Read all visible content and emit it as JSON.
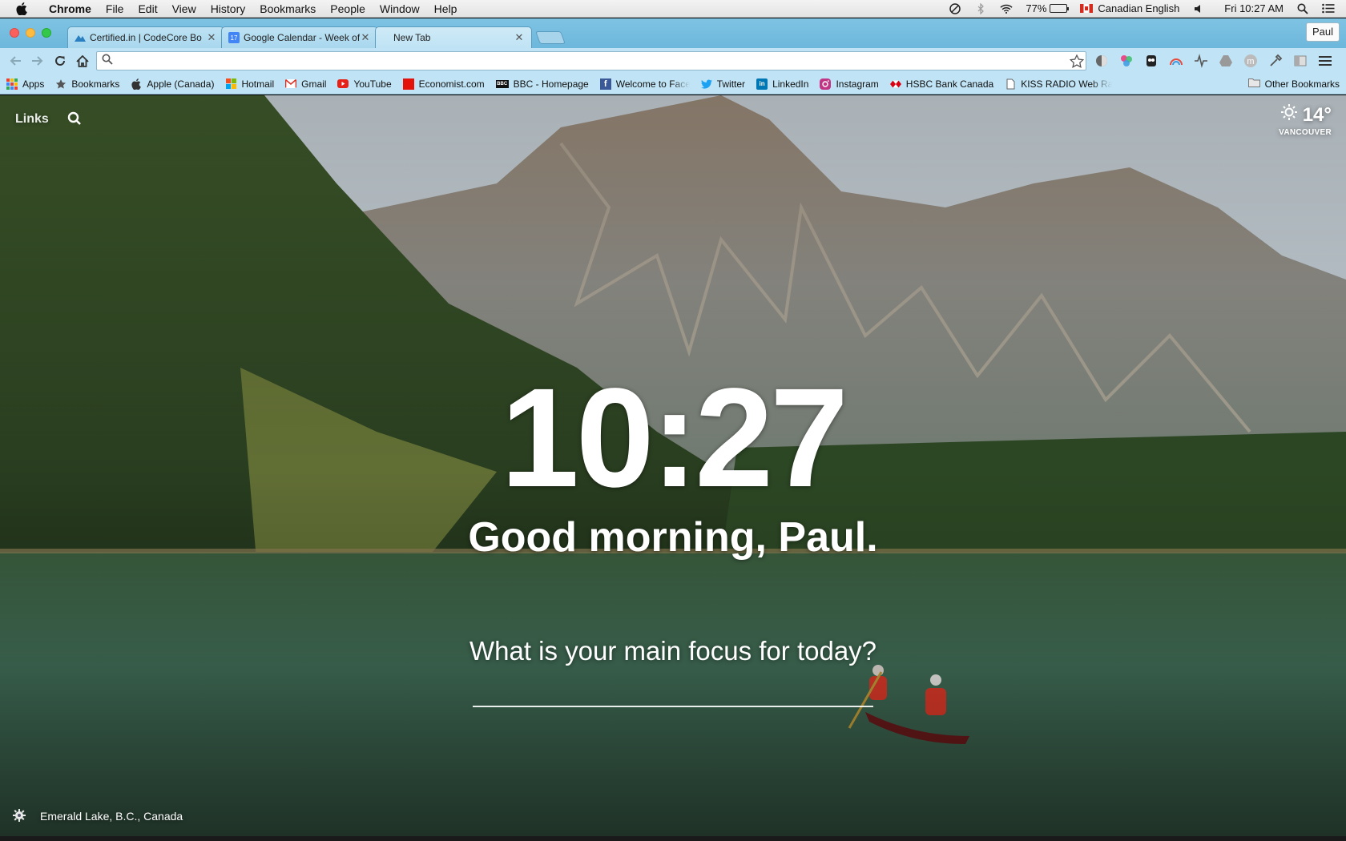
{
  "menubar": {
    "app_name": "Chrome",
    "menus": [
      "File",
      "Edit",
      "View",
      "History",
      "Bookmarks",
      "People",
      "Window",
      "Help"
    ],
    "battery_percent": "77%",
    "input_source": "Canadian English",
    "datetime": "Fri 10:27 AM"
  },
  "tabs": [
    {
      "title": "Certified.in | CodeCore Bo",
      "favicon": "codecore-icon",
      "active": false
    },
    {
      "title": "Google Calendar - Week of",
      "favicon": "calendar-icon",
      "favicon_text": "17",
      "active": false
    },
    {
      "title": "New Tab",
      "favicon": "",
      "active": true
    }
  ],
  "profile_name": "Paul",
  "omnibox": {
    "value": "",
    "placeholder": ""
  },
  "bookmarks": [
    {
      "label": "Apps",
      "icon": "apps-grid-icon"
    },
    {
      "label": "Bookmarks",
      "icon": "star-icon"
    },
    {
      "label": "Apple (Canada)",
      "icon": "apple-icon"
    },
    {
      "label": "Hotmail",
      "icon": "windows-icon"
    },
    {
      "label": "Gmail",
      "icon": "gmail-icon"
    },
    {
      "label": "YouTube",
      "icon": "youtube-icon"
    },
    {
      "label": "Economist.com",
      "icon": "economist-icon"
    },
    {
      "label": "BBC - Homepage",
      "icon": "bbc-icon",
      "icon_text": "BBC"
    },
    {
      "label": "Welcome to Faceboo",
      "icon": "facebook-icon",
      "icon_text": "f"
    },
    {
      "label": "Twitter",
      "icon": "twitter-icon"
    },
    {
      "label": "LinkedIn",
      "icon": "linkedin-icon",
      "icon_text": "in"
    },
    {
      "label": "Instagram",
      "icon": "instagram-icon"
    },
    {
      "label": "HSBC Bank Canada",
      "icon": "hsbc-icon"
    },
    {
      "label": "KISS RADIO Web Rad",
      "icon": "page-icon"
    }
  ],
  "other_bookmarks": "Other Bookmarks",
  "momentum": {
    "links_label": "Links",
    "weather_temp": "14°",
    "weather_city": "VANCOUVER",
    "time": "10:27",
    "greeting": "Good morning, Paul.",
    "focus_question": "What is your main focus for today?",
    "focus_value": "",
    "photo_location": "Emerald Lake, B.C., Canada"
  },
  "colors": {
    "tab_strip": "#7fc3e3",
    "toolbar": "#c0e4f5",
    "youtube": "#e62117",
    "economist": "#e3120b",
    "facebook": "#3b5998",
    "twitter": "#1da1f2",
    "linkedin": "#0077b5",
    "hsbc": "#db0011"
  }
}
